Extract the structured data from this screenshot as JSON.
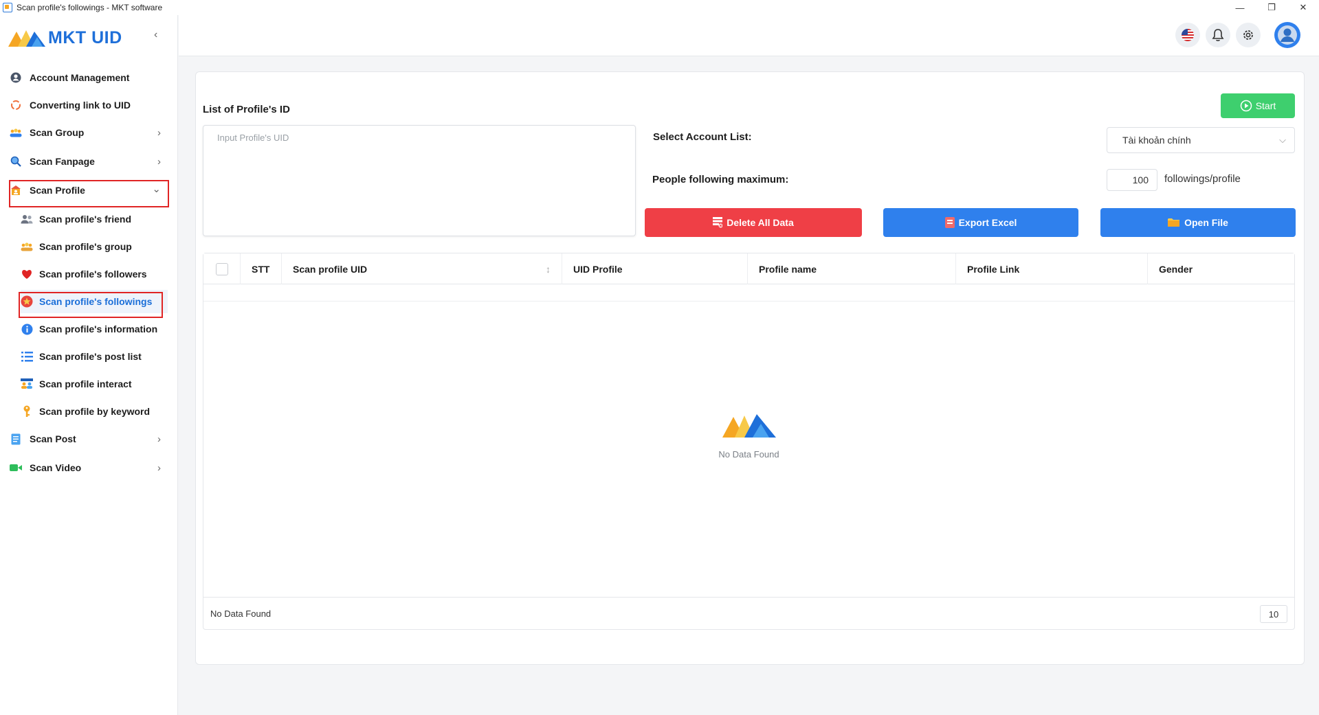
{
  "window": {
    "title": "Scan profile's followings - MKT software",
    "minimize": "—",
    "restore": "❐",
    "close": "✕"
  },
  "brand": {
    "name": "MKT UID",
    "collapse": "‹"
  },
  "sidebar": {
    "items": [
      {
        "label": "Account Management",
        "icon": "user-circle-icon",
        "chevron": ""
      },
      {
        "label": "Converting link to UID",
        "icon": "refresh-icon",
        "chevron": ""
      },
      {
        "label": "Scan Group",
        "icon": "group-icon",
        "chevron": "›"
      },
      {
        "label": "Scan Fanpage",
        "icon": "search-icon",
        "chevron": "›"
      },
      {
        "label": "Scan Profile",
        "icon": "profile-card-icon",
        "chevron": "⌄"
      },
      {
        "label": "Scan Post",
        "icon": "document-icon",
        "chevron": "›"
      },
      {
        "label": "Scan Video",
        "icon": "video-camera-icon",
        "chevron": "›"
      }
    ],
    "subitems": [
      {
        "label": "Scan profile's friend",
        "icon": "friends-icon"
      },
      {
        "label": "Scan profile's group",
        "icon": "group-icon"
      },
      {
        "label": "Scan profile's followers",
        "icon": "heart-icon"
      },
      {
        "label": "Scan profile's followings",
        "icon": "star-badge-icon",
        "active": true
      },
      {
        "label": "Scan profile's information",
        "icon": "info-icon"
      },
      {
        "label": "Scan profile's post list",
        "icon": "list-icon"
      },
      {
        "label": "Scan profile interact",
        "icon": "interact-icon"
      },
      {
        "label": "Scan profile by keyword",
        "icon": "key-icon"
      }
    ]
  },
  "topbar": {
    "icons": [
      "us-flag-icon",
      "bell-icon",
      "gear-icon",
      "avatar-icon"
    ]
  },
  "form": {
    "list_label": "List of Profile's ID",
    "uid_placeholder": "Input Profile's UID",
    "start_label": "Start",
    "select_account_label": "Select Account List:",
    "select_account_value": "Tài khoản chính",
    "max_label": "People following maximum:",
    "max_value": "100",
    "max_unit": "followings/profile",
    "delete_label": "Delete All Data",
    "export_label": "Export Excel",
    "open_label": "Open File"
  },
  "table": {
    "columns": [
      "STT",
      "Scan profile UID",
      "UID Profile",
      "Profile name",
      "Profile Link",
      "Gender"
    ],
    "empty_text": "No Data Found",
    "footer_text": "No Data Found",
    "page_size": "10",
    "sort_indicator": "↕"
  },
  "colors": {
    "accent": "#1a6ed8",
    "start_green": "#3ecf6e",
    "delete_red": "#ef3f46",
    "action_blue": "#2f80ed",
    "highlight_box": "#e02424"
  }
}
